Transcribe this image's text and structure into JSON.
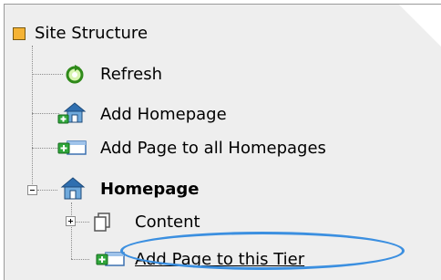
{
  "tree": {
    "root": {
      "label": "Site Structure",
      "icon": "square-folder-icon",
      "color": "#f5b335"
    },
    "items": [
      {
        "label": "Refresh",
        "icon": "refresh-icon"
      },
      {
        "label": "Add Homepage",
        "icon": "add-homepage-icon"
      },
      {
        "label": "Add Page to all Homepages",
        "icon": "add-page-icon"
      },
      {
        "label": "Homepage",
        "icon": "homepage-icon",
        "expanded": true
      },
      {
        "label": "Content",
        "icon": "content-pages-icon",
        "expanded": false
      },
      {
        "label": "Add Page to this Tier",
        "icon": "add-page-icon",
        "highlighted": true
      }
    ]
  },
  "colors": {
    "highlight_oval": "#3b8fe0",
    "panel_bg": "#eeeeee"
  }
}
